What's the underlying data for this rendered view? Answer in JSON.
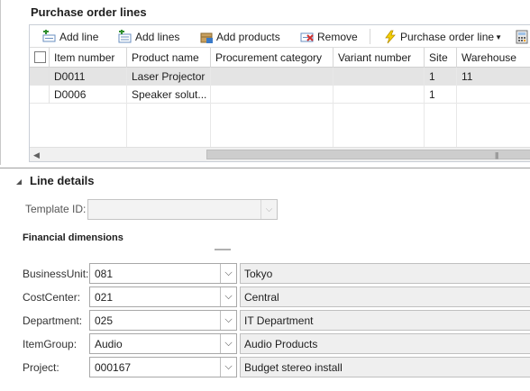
{
  "po_lines": {
    "title": "Purchase order lines",
    "toolbar": {
      "add_line": "Add line",
      "add_lines": "Add lines",
      "add_products": "Add products",
      "remove": "Remove",
      "purchase_order_line": "Purchase order line"
    },
    "columns": [
      "Item number",
      "Product name",
      "Procurement category",
      "Variant number",
      "Site",
      "Warehouse"
    ],
    "rows": [
      {
        "item": "D0011",
        "product": "Laser Projector",
        "category": "",
        "variant": "",
        "site": "1",
        "warehouse": "11"
      },
      {
        "item": "D0006",
        "product": "Speaker solut...",
        "category": "",
        "variant": "",
        "site": "1",
        "warehouse": ""
      }
    ]
  },
  "line_details": {
    "title": "Line details",
    "template_label": "Template ID:",
    "template_value": "",
    "financial_title": "Financial dimensions",
    "dimensions": [
      {
        "label": "BusinessUnit:",
        "value": "081",
        "description": "Tokyo"
      },
      {
        "label": "CostCenter:",
        "value": "021",
        "description": "Central"
      },
      {
        "label": "Department:",
        "value": "025",
        "description": "IT Department"
      },
      {
        "label": "ItemGroup:",
        "value": "Audio",
        "description": "Audio Products"
      },
      {
        "label": "Project:",
        "value": "000167",
        "description": "Budget stereo install"
      }
    ]
  },
  "colors": {
    "selected_row": "#e4e4e4",
    "description_bg": "#efefef",
    "border": "#a8a8a8"
  }
}
